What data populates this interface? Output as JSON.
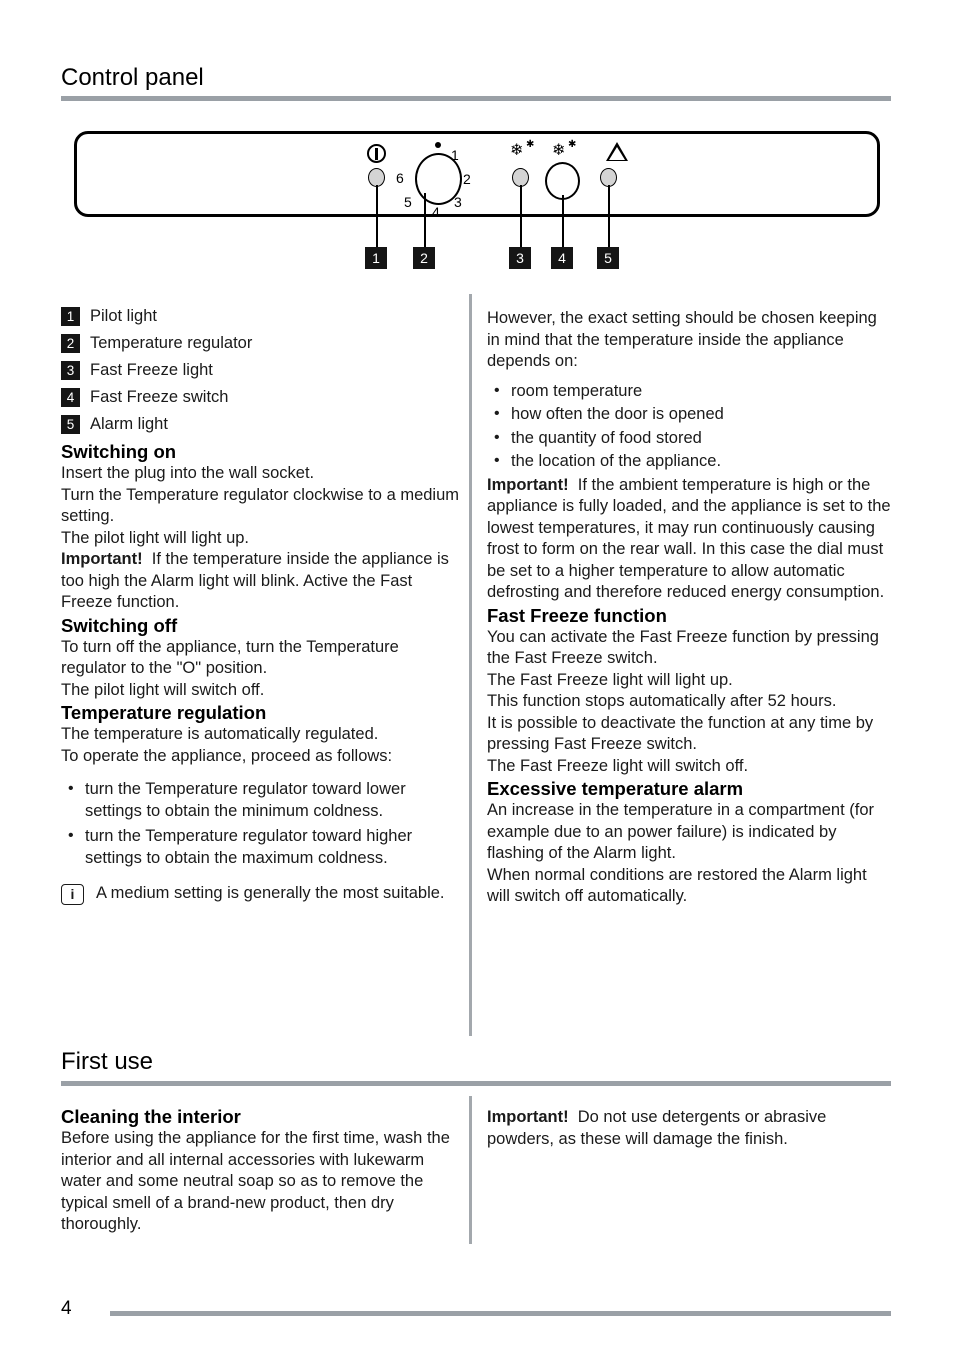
{
  "page": {
    "number": "4"
  },
  "sections": {
    "control_panel": {
      "title": "Control panel"
    },
    "first_use": {
      "title": "First use"
    }
  },
  "figure": {
    "icons": {
      "power": "power-icon",
      "snowflake": "snowflake-icon",
      "warning": "warning-triangle-icon"
    },
    "dial_numbers": [
      "1",
      "2",
      "3",
      "4",
      "5",
      "6"
    ],
    "callouts": [
      "1",
      "2",
      "3",
      "4",
      "5"
    ]
  },
  "legend": [
    {
      "num": "1",
      "label": "Pilot light"
    },
    {
      "num": "2",
      "label": "Temperature regulator"
    },
    {
      "num": "3",
      "label": "Fast Freeze light"
    },
    {
      "num": "4",
      "label": "Fast Freeze switch"
    },
    {
      "num": "5",
      "label": "Alarm light"
    }
  ],
  "left_column": {
    "switching_on": {
      "heading": "Switching on",
      "para1": "Insert the plug into the wall socket.",
      "para2": "Turn the Temperature regulator clockwise to a medium setting.",
      "para3": "The pilot light will light up.",
      "important_label": "Important!",
      "important_text": "If the temperature inside the appliance is too high the Alarm light will blink. Active the Fast Freeze function."
    },
    "switching_off": {
      "heading": "Switching off",
      "para1": "To turn off the appliance, turn the Temperature regulator to the \"O\" position.",
      "para2": "The pilot light will switch off."
    },
    "temperature_regulation": {
      "heading": "Temperature regulation",
      "para1": "The temperature is automatically regulated.",
      "para2": "To operate the appliance, proceed as follows:",
      "bullets": [
        "turn the Temperature regulator toward lower settings to obtain the minimum coldness.",
        "turn the Temperature regulator toward higher settings to obtain the maximum coldness."
      ],
      "note_icon": "i",
      "note_text": "A medium setting is generally the most suitable."
    }
  },
  "right_column": {
    "intro": {
      "para1": "However, the exact setting should be chosen keeping in mind that the temperature inside the appliance depends on:",
      "bullets": [
        "room temperature",
        "how often the door is opened",
        "the quantity of food stored",
        "the location of the appliance."
      ],
      "important_label": "Important!",
      "important_text": "If the ambient temperature is high or the appliance is fully loaded, and the appliance is set to the lowest temperatures, it may run continuously causing frost to form on the rear wall. In this case the dial must be set to a higher temperature to allow automatic defrosting and therefore reduced energy consumption."
    },
    "fast_freeze": {
      "heading": "Fast Freeze function",
      "para1": "You can activate the Fast Freeze function by pressing the Fast Freeze switch.",
      "para2": "The Fast Freeze light will light up.",
      "para3": "This function stops automatically after 52 hours.",
      "para4": "It is possible to deactivate the function at any time by pressing Fast Freeze switch.",
      "para5": "The Fast Freeze light will switch off."
    },
    "alarm": {
      "heading": "Excessive temperature alarm",
      "para1": "An increase in the temperature in a compartment (for example due to an power failure) is indicated by flashing of the Alarm light.",
      "para2": "When normal conditions are restored the Alarm light will switch off automatically."
    }
  },
  "first_use": {
    "left": {
      "heading": "Cleaning the interior",
      "para1": "Before using the appliance for the first time, wash the interior and all internal accessories with lukewarm water and some neutral soap so as to remove the typical smell of a brand-new product, then dry thoroughly."
    },
    "right": {
      "important_label": "Important!",
      "important_text": "Do not use detergents or abrasive powders, as these will damage the finish."
    }
  },
  "colors": {
    "rule": "#9aa0a6",
    "divider": "#a3a8ad",
    "callout_bg": "#151515",
    "led_fill": "#d4d4d4"
  }
}
